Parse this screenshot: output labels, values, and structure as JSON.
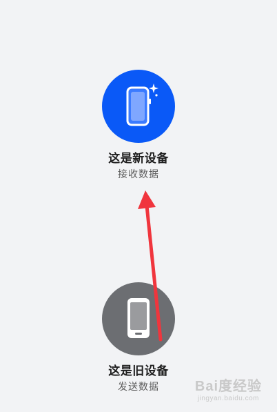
{
  "options": {
    "new_device": {
      "title": "这是新设备",
      "subtitle": "接收数据",
      "icon": "new-phone-icon",
      "circle_color": "#0a59f7"
    },
    "old_device": {
      "title": "这是旧设备",
      "subtitle": "发送数据",
      "icon": "old-phone-icon",
      "circle_color": "#6c6e72"
    }
  },
  "annotation": {
    "arrow_color": "#f0353d"
  },
  "watermark": {
    "logo": "Bai度经验",
    "url": "jingyan.baidu.com"
  }
}
